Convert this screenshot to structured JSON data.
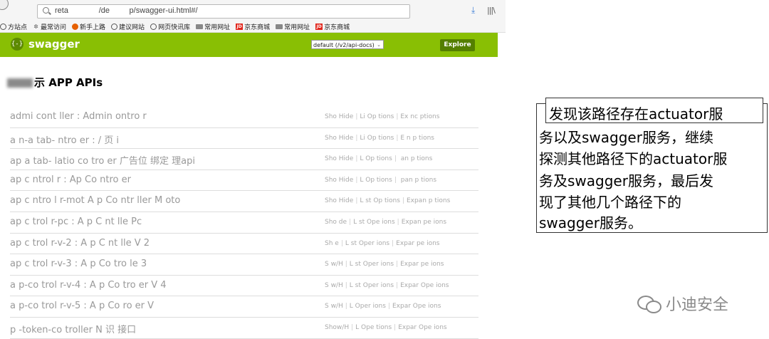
{
  "browser": {
    "url": "reta              /de         p/swagger-ui.html#/",
    "bookmarks": [
      {
        "icon": "globe",
        "label": "方站点"
      },
      {
        "icon": "star",
        "label": "最常访问"
      },
      {
        "icon": "ff",
        "label": "新手上路"
      },
      {
        "icon": "globe",
        "label": "建议网站"
      },
      {
        "icon": "globe",
        "label": "网页快讯库"
      },
      {
        "icon": "folder",
        "label": "常用网址"
      },
      {
        "icon": "jd",
        "label": "京东商城"
      },
      {
        "icon": "folder",
        "label": "常用网址"
      },
      {
        "icon": "jd",
        "label": "京东商城"
      }
    ]
  },
  "swagger": {
    "logo_glyph": "{-}",
    "title": "swagger",
    "spec_select": "default (/v2/api-docs)",
    "explore_label": "Explore"
  },
  "api_title": "示 APP APIs",
  "resources": [
    {
      "name": "admi   cont    ller : Admin   ontro    r",
      "ops": [
        "Sho    Hide",
        "Li    Op    tions",
        "Ex    nc      ptions"
      ]
    },
    {
      "name": "a   n-a    tab-    ntro    er : /     页     i",
      "ops": [
        "Sho    Hide",
        "Li    Op    tions",
        "E    n      p    tions"
      ]
    },
    {
      "name": "ap   a    tab-    latio    co     tro    er    广告位    绑定     理api",
      "ops": [
        "Sho    Hide",
        "L    Op    tions",
        "    an    p    tions"
      ]
    },
    {
      "name": "ap    c    ntrol    r : Ap    Co    ntro    er",
      "ops": [
        "Sho    Hide",
        "L    Op    tions",
        "    pan    p    tions"
      ]
    },
    {
      "name": "ap    c    ntro    l    r-mot    A    p Co    ntr    ller    M    oto",
      "ops": [
        "Sho    Hide",
        "L    st Op    tions",
        "Expan    p    tions"
      ]
    },
    {
      "name": "ap    c    trol    r-pc : A    p C    nt    lle    Pc",
      "ops": [
        "Sho    de",
        "L    st Ope    ions",
        "Expan    pe    ions"
      ]
    },
    {
      "name": "ap    c    trol    r-v-2 : A    p C    nt    lle    V 2",
      "ops": [
        "Sh    e",
        "L    st Oper    ions",
        "Expar    pe    ions"
      ]
    },
    {
      "name": "ap    c    trol    r-v-3 : A    p Co    tro    le    3",
      "ops": [
        "S    w/H",
        "L    st Oper    ions",
        "Expar    pe    ions"
      ]
    },
    {
      "name": "a    p-co    trol    r-v-4 : A    p Co    tro    er V 4",
      "ops": [
        "S    w/H",
        "L    st Oper    ions",
        "Expar    Ope    ions"
      ]
    },
    {
      "name": "a    p-co    trol    r-v-5 : A    p Co    ro    er V",
      "ops": [
        "S    w/H",
        "L    Oper    ions",
        "Expar    Ope    ions"
      ]
    },
    {
      "name": "p    -token-co    troller    N 识        接口",
      "ops": [
        "Show/H",
        "L    Ope    tions",
        "Expar    Ope    ions"
      ]
    }
  ],
  "annotation": {
    "lines": [
      "发现该路径存在actuator服",
      "务以及swagger服务，继续",
      "探测其他路径下的actuator服",
      "务及swagger服务，最后发",
      "现了其他几个路径下的",
      "swagger服务。"
    ]
  },
  "watermark": {
    "text": "小迪安全"
  }
}
